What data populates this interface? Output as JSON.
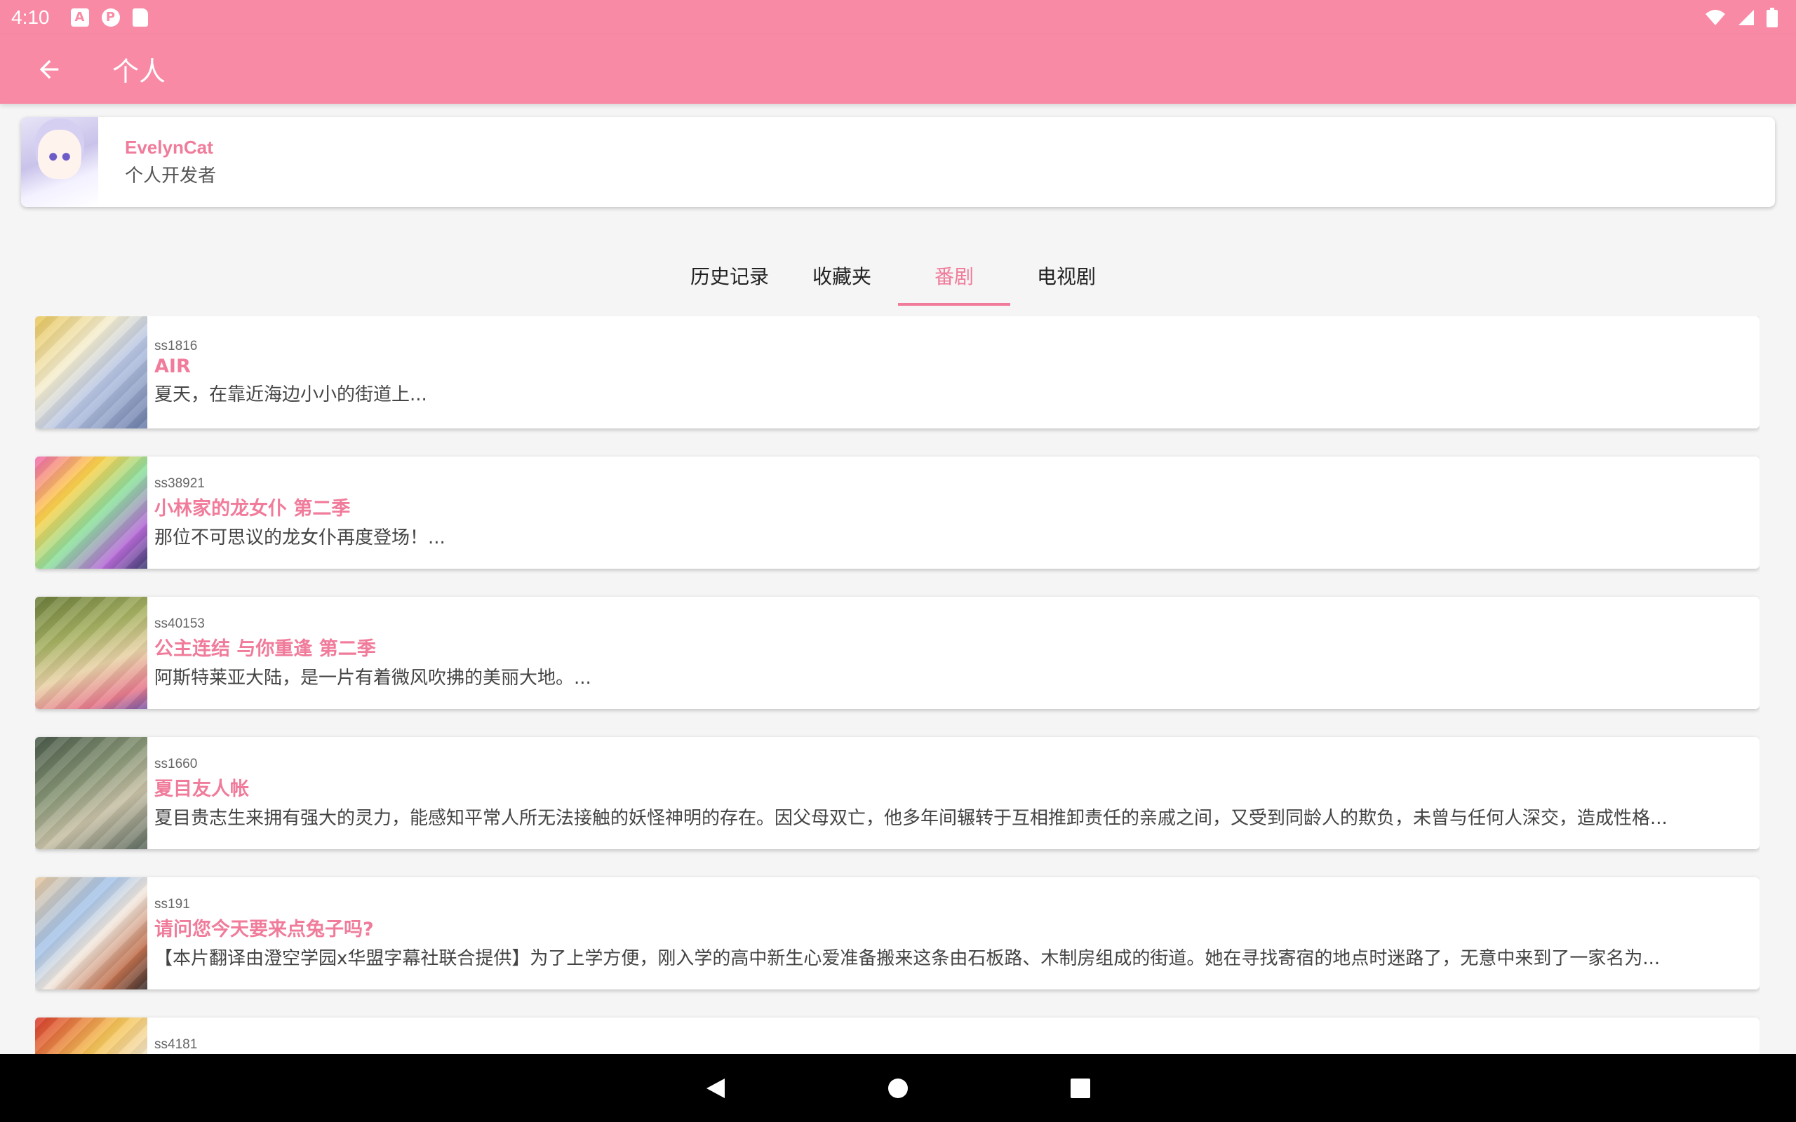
{
  "status_bar": {
    "time": "4:10",
    "left_icons": [
      "a-box-icon",
      "app-circle-icon",
      "sd-card-icon"
    ],
    "right_icons": [
      "wifi-icon",
      "signal-icon",
      "battery-icon"
    ]
  },
  "app_bar": {
    "back_icon": "arrow-back-icon",
    "title": "个人"
  },
  "profile": {
    "name": "EvelynCat",
    "role": "个人开发者"
  },
  "tabs": [
    {
      "label": "历史记录",
      "active": false
    },
    {
      "label": "收藏夹",
      "active": false
    },
    {
      "label": "番剧",
      "active": true
    },
    {
      "label": "电视剧",
      "active": false
    }
  ],
  "items": [
    {
      "id": "ss1816",
      "title": "AIR",
      "desc": "夏天，在靠近海边小小的街道上..."
    },
    {
      "id": "ss38921",
      "title": "小林家的龙女仆 第二季",
      "desc": "那位不可思议的龙女仆再度登场！..."
    },
    {
      "id": "ss40153",
      "title": "公主连结 与你重逢 第二季",
      "desc": "阿斯特莱亚大陆，是一片有着微风吹拂的美丽大地。..."
    },
    {
      "id": "ss1660",
      "title": "夏目友人帐",
      "desc": "夏目贵志生来拥有强大的灵力，能感知平常人所无法接触的妖怪神明的存在。因父母双亡，他多年间辗转于互相推卸责任的亲戚之间，又受到同龄人的欺负，未曾与任何人深交，造成性格..."
    },
    {
      "id": "ss191",
      "title": "请问您今天要来点兔子吗?",
      "desc": "【本片翻译由澄空学园x华盟字幕社联合提供】为了上学方便，刚入学的高中新生心爱准备搬来这条由石板路、木制房组成的街道。她在寻找寄宿的地点时迷路了，无意中来到了一家名为..."
    },
    {
      "id": "ss4181",
      "title": "",
      "desc": ""
    }
  ],
  "nav_bar": [
    "back-triangle-icon",
    "home-circle-icon",
    "recents-square-icon"
  ],
  "colors": {
    "accent": "#f98aa5",
    "title_pink": "#f07b9a"
  }
}
